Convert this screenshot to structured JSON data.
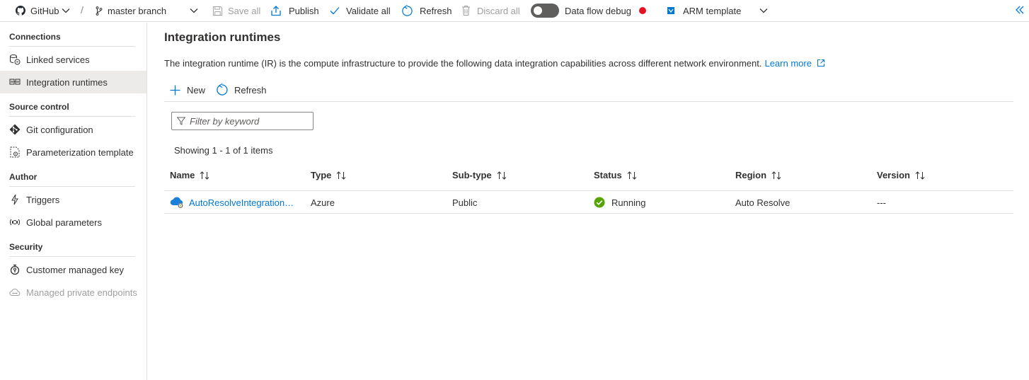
{
  "toolbar": {
    "repo_label": "GitHub",
    "branch_label": "master branch",
    "save_all": "Save all",
    "publish": "Publish",
    "validate_all": "Validate all",
    "refresh": "Refresh",
    "discard_all": "Discard all",
    "data_flow_debug": "Data flow debug",
    "arm_template": "ARM template",
    "separator": "/"
  },
  "sidebar": {
    "sections": [
      {
        "label": "Connections"
      },
      {
        "label": "Source control"
      },
      {
        "label": "Author"
      },
      {
        "label": "Security"
      }
    ],
    "items": [
      {
        "label": "Linked services",
        "icon": "linked-services-icon"
      },
      {
        "label": "Integration runtimes",
        "icon": "integration-runtime-icon"
      },
      {
        "label": "Git configuration",
        "icon": "git-icon"
      },
      {
        "label": "Parameterization template",
        "icon": "template-icon"
      },
      {
        "label": "Triggers",
        "icon": "lightning-icon"
      },
      {
        "label": "Global parameters",
        "icon": "global-parameters-icon"
      },
      {
        "label": "Customer managed key",
        "icon": "key-icon"
      },
      {
        "label": "Managed private endpoints",
        "icon": "cloud-link-icon"
      }
    ],
    "selected": "Integration runtimes"
  },
  "main": {
    "title": "Integration runtimes",
    "description": "The integration runtime (IR) is the compute infrastructure to provide the following data integration capabilities across different network environment.",
    "learn_more": "Learn more",
    "new_label": "New",
    "refresh_label": "Refresh",
    "filter_placeholder": "Filter by keyword",
    "showing": "Showing 1 - 1 of 1 items",
    "columns": [
      "Name",
      "Type",
      "Sub-type",
      "Status",
      "Region",
      "Version"
    ],
    "rows": [
      {
        "name": "AutoResolveIntegrationR...",
        "type": "Azure",
        "subtype": "Public",
        "status": "Running",
        "region": "Auto Resolve",
        "version": "---"
      }
    ]
  },
  "colors": {
    "accent": "#0078d4",
    "status_running": "#57a300",
    "debug_dot": "#e81123",
    "selected_bg": "#edebe9"
  }
}
